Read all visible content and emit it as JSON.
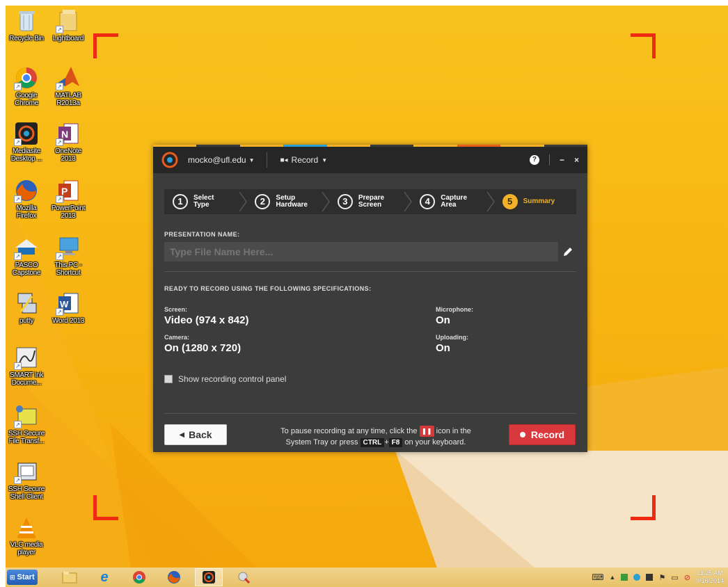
{
  "desktop_icons": [
    {
      "name": "recycle-bin",
      "label": "Recycle Bin"
    },
    {
      "name": "lightboard",
      "label": "Lightboard"
    },
    {
      "name": "google-chrome",
      "label": "Google\nChrome"
    },
    {
      "name": "matlab",
      "label": "MATLAB\nR2013a"
    },
    {
      "name": "mediasite-desktop",
      "label": "Mediasite\nDesktop ..."
    },
    {
      "name": "onenote",
      "label": "OneNote\n2013"
    },
    {
      "name": "mozilla-firefox",
      "label": "Mozilla\nFirefox"
    },
    {
      "name": "powerpoint",
      "label": "PowerPoint\n2013"
    },
    {
      "name": "pasco-capstone",
      "label": "PASCO\nCapstone"
    },
    {
      "name": "this-pc",
      "label": "This PC -\nShortcut"
    },
    {
      "name": "putty",
      "label": "putty"
    },
    {
      "name": "word",
      "label": "Word 2013"
    },
    {
      "name": "smart-ink",
      "label": "SMART Ink\nDocume..."
    },
    {
      "name": "ssh-file-transfer",
      "label": "SSH Secure\nFile Transf..."
    },
    {
      "name": "ssh-shell-client",
      "label": "SSH Secure\nShell Client"
    },
    {
      "name": "vlc",
      "label": "VLC media\nplayer"
    }
  ],
  "dialog": {
    "user": "mocko@ufl.edu",
    "record_menu": "Record",
    "help": "?",
    "minimize": "−",
    "close": "×",
    "steps": [
      {
        "num": "1",
        "label": "Select\nType"
      },
      {
        "num": "2",
        "label": "Setup\nHardware"
      },
      {
        "num": "3",
        "label": "Prepare\nScreen"
      },
      {
        "num": "4",
        "label": "Capture\nArea"
      },
      {
        "num": "5",
        "label": "Summary"
      }
    ],
    "presentation_name_label": "PRESENTATION NAME:",
    "presentation_name_placeholder": "Type File Name Here...",
    "ready_label": "READY TO RECORD USING THE FOLLOWING SPECIFICATIONS:",
    "specs": {
      "screen_label": "Screen:",
      "screen_value": "Video (974 x 842)",
      "camera_label": "Camera:",
      "camera_value": "On (1280 x 720)",
      "microphone_label": "Microphone:",
      "microphone_value": "On",
      "uploading_label": "Uploading:",
      "uploading_value": "On"
    },
    "show_panel_label": "Show recording control panel",
    "back_label": "Back",
    "hint_part1": "To pause recording at any time, click the",
    "hint_part2": "icon in the",
    "hint_part3": "System Tray or press",
    "hint_key1": "CTRL",
    "hint_plus": "+",
    "hint_key2": "F8",
    "hint_part4": "on your keyboard.",
    "record_label": "Record"
  },
  "taskbar": {
    "start_label": "Start",
    "time": "11:25 AM",
    "date": "9/16/2014"
  },
  "colors": {
    "accent_record": "#d9383c",
    "accent_step_active": "#f2b126",
    "capture_corner": "#ee2a12"
  }
}
